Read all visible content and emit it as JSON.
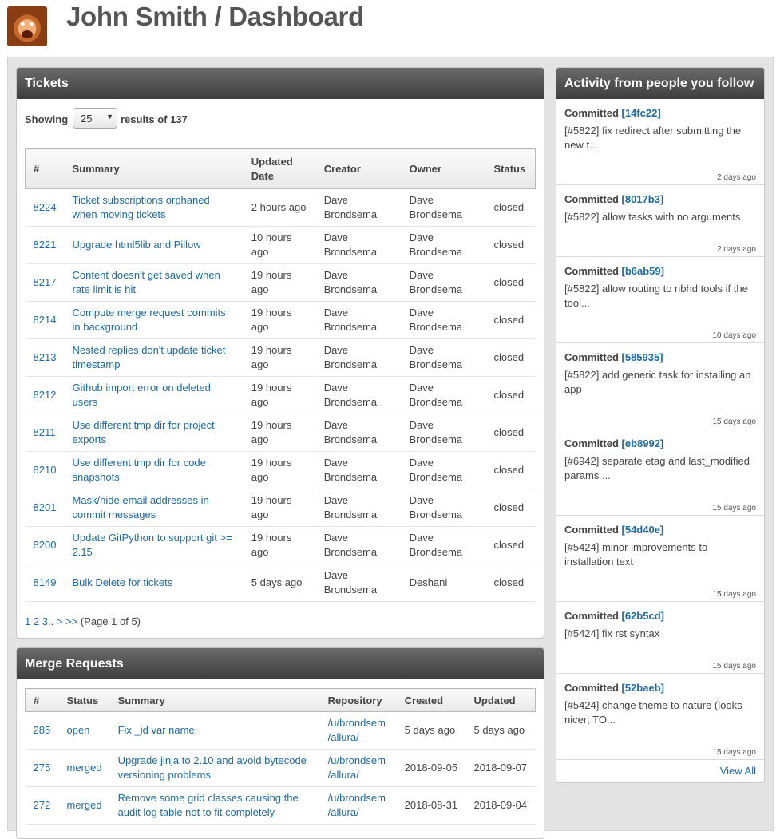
{
  "header": {
    "title": "John Smith / Dashboard"
  },
  "tickets": {
    "heading": "Tickets",
    "showing_label": "Showing",
    "page_size": "25",
    "results_label": "results of 137",
    "columns": [
      "#",
      "Summary",
      "Updated Date",
      "Creator",
      "Owner",
      "Status"
    ],
    "rows": [
      {
        "num": "8224",
        "summary": "Ticket subscriptions orphaned when moving tickets",
        "updated": "2 hours ago",
        "creator": "Dave Brondsema",
        "owner": "Dave Brondsema",
        "status": "closed"
      },
      {
        "num": "8221",
        "summary": "Upgrade html5lib and Pillow",
        "updated": "10 hours ago",
        "creator": "Dave Brondsema",
        "owner": "Dave Brondsema",
        "status": "closed"
      },
      {
        "num": "8217",
        "summary": "Content doesn't get saved when rate limit is hit",
        "updated": "19 hours ago",
        "creator": "Dave Brondsema",
        "owner": "Dave Brondsema",
        "status": "closed"
      },
      {
        "num": "8214",
        "summary": "Compute merge request commits in background",
        "updated": "19 hours ago",
        "creator": "Dave Brondsema",
        "owner": "Dave Brondsema",
        "status": "closed"
      },
      {
        "num": "8213",
        "summary": "Nested replies don't update ticket timestamp",
        "updated": "19 hours ago",
        "creator": "Dave Brondsema",
        "owner": "Dave Brondsema",
        "status": "closed"
      },
      {
        "num": "8212",
        "summary": "Github import error on deleted users",
        "updated": "19 hours ago",
        "creator": "Dave Brondsema",
        "owner": "Dave Brondsema",
        "status": "closed"
      },
      {
        "num": "8211",
        "summary": "Use different tmp dir for project exports",
        "updated": "19 hours ago",
        "creator": "Dave Brondsema",
        "owner": "Dave Brondsema",
        "status": "closed"
      },
      {
        "num": "8210",
        "summary": "Use different tmp dir for code snapshots",
        "updated": "19 hours ago",
        "creator": "Dave Brondsema",
        "owner": "Dave Brondsema",
        "status": "closed"
      },
      {
        "num": "8201",
        "summary": "Mask/hide email addresses in commit messages",
        "updated": "19 hours ago",
        "creator": "Dave Brondsema",
        "owner": "Dave Brondsema",
        "status": "closed"
      },
      {
        "num": "8200",
        "summary": "Update GitPython to support git >= 2.15",
        "updated": "19 hours ago",
        "creator": "Dave Brondsema",
        "owner": "Dave Brondsema",
        "status": "closed"
      },
      {
        "num": "8149",
        "summary": "Bulk Delete for tickets",
        "updated": "5 days ago",
        "creator": "Dave Brondsema",
        "owner": "Deshani",
        "status": "closed"
      }
    ],
    "pager": {
      "p1": "1",
      "p2": "2",
      "p3": "3",
      "ellipsis": "..",
      "next": ">",
      "last": ">>",
      "info": "(Page 1 of 5)"
    }
  },
  "merge_requests": {
    "heading": "Merge Requests",
    "columns": [
      "#",
      "Status",
      "Summary",
      "Repository",
      "Created",
      "Updated"
    ],
    "rows": [
      {
        "num": "285",
        "status": "open",
        "summary": "Fix _id var name",
        "repo": "/u/brondsem /allura/",
        "created": "5 days ago",
        "updated": "5 days ago"
      },
      {
        "num": "275",
        "status": "merged",
        "summary": "Upgrade jinja to 2.10 and avoid bytecode versioning problems",
        "repo": "/u/brondsem /allura/",
        "created": "2018-09-05",
        "updated": "2018-09-07"
      },
      {
        "num": "272",
        "status": "merged",
        "summary": "Remove some grid classes causing the audit log table not to fit completely",
        "repo": "/u/brondsem /allura/",
        "created": "2018-08-31",
        "updated": "2018-09-04"
      }
    ]
  },
  "activity": {
    "heading": "Activity from people you follow",
    "items": [
      {
        "label": "Committed",
        "commit": "[14fc22]",
        "text": "[#5822] fix redirect after submitting the new t...",
        "time": "2 days ago"
      },
      {
        "label": "Committed",
        "commit": "[8017b3]",
        "text": "[#5822] allow tasks with no arguments",
        "time": "2 days ago"
      },
      {
        "label": "Committed",
        "commit": "[b6ab59]",
        "text": "[#5822] allow routing to nbhd tools if the tool...",
        "time": "10 days ago"
      },
      {
        "label": "Committed",
        "commit": "[585935]",
        "text": "[#5822] add generic task for installing an app",
        "time": "15 days ago"
      },
      {
        "label": "Committed",
        "commit": "[eb8992]",
        "text": "[#6942] separate etag and last_modified params ...",
        "time": "15 days ago"
      },
      {
        "label": "Committed",
        "commit": "[54d40e]",
        "text": "[#5424] minor improvements to installation text",
        "time": "15 days ago"
      },
      {
        "label": "Committed",
        "commit": "[62b5cd]",
        "text": "[#5424] fix rst syntax",
        "time": "15 days ago"
      },
      {
        "label": "Committed",
        "commit": "[52baeb]",
        "text": "[#5424] change theme to nature (looks nicer; TO...",
        "time": "15 days ago"
      }
    ],
    "view_all": "View All"
  }
}
